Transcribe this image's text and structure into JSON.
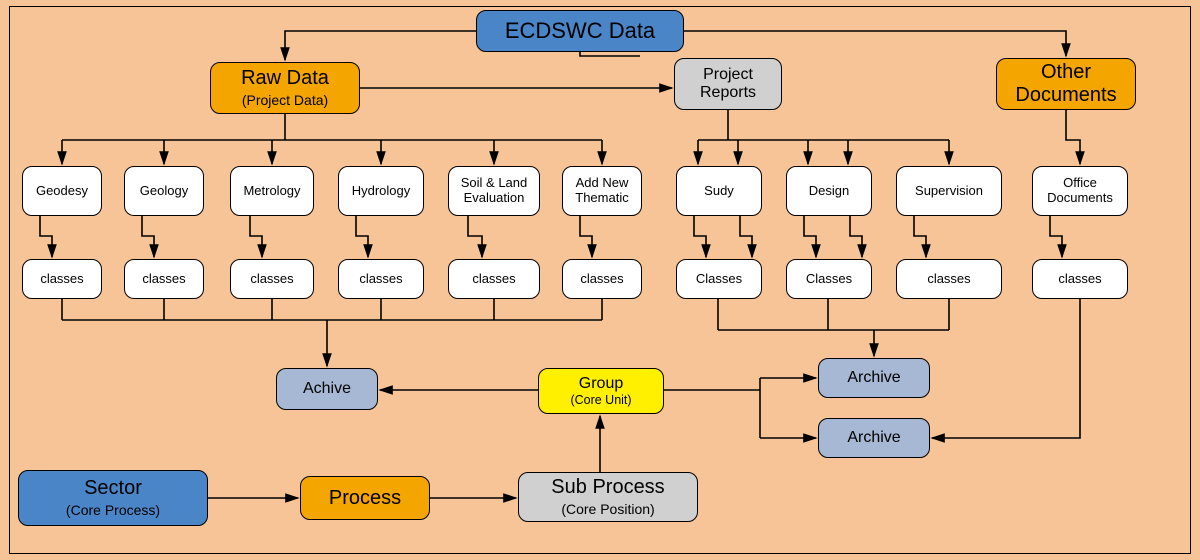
{
  "title": "ECDSWC Data",
  "raw_data": {
    "main": "Raw Data",
    "sub": "(Project Data)"
  },
  "project_reports": {
    "line1": "Project",
    "line2": "Reports"
  },
  "other_documents": {
    "line1": "Other",
    "line2": "Documents"
  },
  "thematic": {
    "geodesy": "Geodesy",
    "geology": "Geology",
    "metrology": "Metrology",
    "hydrology": "Hydrology",
    "soil_land": {
      "line1": "Soil & Land",
      "line2": "Evaluation"
    },
    "add_new": {
      "line1": "Add New",
      "line2": "Thematic"
    }
  },
  "project_reports_children": {
    "study": "Sudy",
    "design": "Design",
    "supervision": "Supervision"
  },
  "other_docs_children": {
    "office_docs": {
      "line1": "Office",
      "line2": "Documents"
    }
  },
  "classes_lower": "classes",
  "classes_upper": "Classes",
  "achive": "Achive",
  "group": {
    "main": "Group",
    "sub": "(Core Unit)"
  },
  "archive1": "Archive",
  "archive2": "Archive",
  "sector": {
    "main": "Sector",
    "sub": "(Core Process)"
  },
  "process": "Process",
  "sub_process": {
    "main": "Sub Process",
    "sub": "(Core Position)"
  }
}
